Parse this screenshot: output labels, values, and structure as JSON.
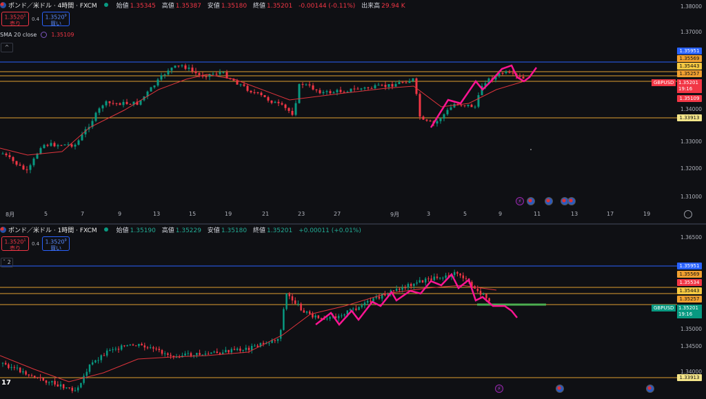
{
  "colors": {
    "up": "#089981",
    "down": "#f23645",
    "sma": "#e0343c",
    "level": "#e0a030",
    "blue_line": "#2962ff",
    "drawing": "#ff1493",
    "green_line": "#4caf50"
  },
  "pane1": {
    "symbol": "ポンド／米ドル · 4時間 · FXCM",
    "ohlc": {
      "open_label": "始値",
      "open": "1.35345",
      "high_label": "高値",
      "high": "1.35387",
      "low_label": "安値",
      "low": "1.35180",
      "close_label": "終値",
      "close": "1.35201",
      "change": "-0.00144 (-0.11%)",
      "volume_label": "出来高",
      "volume": "29.94 K"
    },
    "sell": {
      "price": "1.3520",
      "sup": "1",
      "label": "売り"
    },
    "buy": {
      "price": "1.3520",
      "sup": "9",
      "label": "買い"
    },
    "spread": "0.4",
    "indicator": {
      "name": "SMA 20 close",
      "value": "1.35109"
    },
    "collapse": "^",
    "yaxis": [
      "1.38000",
      "1.37000",
      "1.36000",
      "1.35000",
      "1.34000",
      "1.33000",
      "1.32000",
      "1.31000"
    ],
    "tags": [
      {
        "text": "1.35951",
        "color": "#2962ff",
        "fg": "#fff"
      },
      {
        "text": "1.35569",
        "color": "#f0a030",
        "fg": "#111"
      },
      {
        "text": "1.35443",
        "color": "#f5c842",
        "fg": "#111"
      },
      {
        "text": "1.35257",
        "color": "#f0a030",
        "fg": "#111"
      },
      {
        "text": "1.35109",
        "color": "#f23645",
        "fg": "#fff"
      },
      {
        "text": "1.33913",
        "color": "#f5e68a",
        "fg": "#111"
      }
    ],
    "current": {
      "symbol": "GBPUSD",
      "price": "1.35201",
      "countdown": "19:16"
    },
    "xaxis": [
      "8月",
      "5",
      "7",
      "9",
      "13",
      "15",
      "19",
      "21",
      "23",
      "27",
      "9月",
      "3",
      "5",
      "9",
      "11",
      "13",
      "17",
      "19"
    ]
  },
  "pane2": {
    "symbol": "ポンド／米ドル · 1時間 · FXCM",
    "ohlc": {
      "open_label": "始値",
      "open": "1.35190",
      "high_label": "高値",
      "high": "1.35229",
      "low_label": "安値",
      "low": "1.35180",
      "close_label": "終値",
      "close": "1.35201",
      "change": "+0.00011 (+0.01%)"
    },
    "sell": {
      "price": "1.3520",
      "sup": "1",
      "label": "売り"
    },
    "buy": {
      "price": "1.3520",
      "sup": "9",
      "label": "買い"
    },
    "spread": "0.4",
    "collapse": "ˇ 2",
    "yaxis": [
      "1.36500",
      "1.35000",
      "1.34500",
      "1.34000"
    ],
    "tags": [
      {
        "text": "1.35951",
        "color": "#2962ff",
        "fg": "#fff"
      },
      {
        "text": "1.35569",
        "color": "#f0a030",
        "fg": "#111"
      },
      {
        "text": "1.35534",
        "color": "#f23645",
        "fg": "#fff"
      },
      {
        "text": "1.35443",
        "color": "#f5c842",
        "fg": "#111"
      },
      {
        "text": "1.35257",
        "color": "#f0a030",
        "fg": "#111"
      },
      {
        "text": "1.33913",
        "color": "#f5e68a",
        "fg": "#111"
      }
    ],
    "current": {
      "symbol": "GBPUSD",
      "price": "1.35201",
      "countdown": "19:16"
    },
    "logo": "17"
  }
}
